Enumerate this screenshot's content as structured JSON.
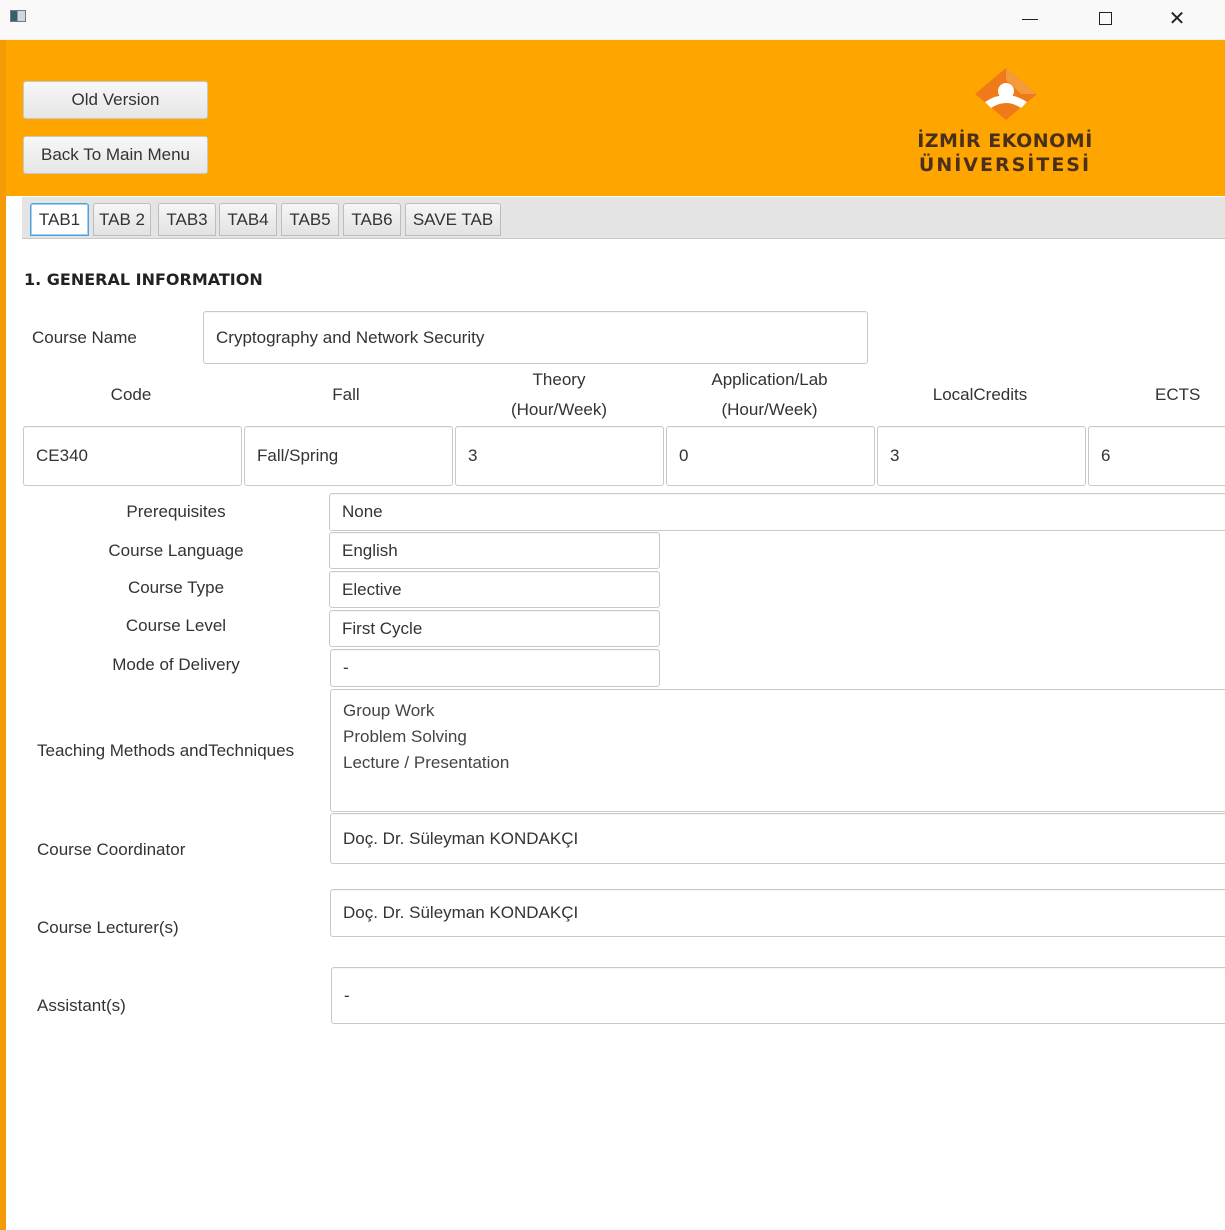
{
  "window": {
    "minimize_glyph": "—",
    "close_glyph": "✕"
  },
  "header": {
    "old_version_label": "Old Version",
    "back_label": "Back To Main Menu",
    "logo_line1": "İZMİR EKONOMİ",
    "logo_line2": "ÜNİVERSİTESİ",
    "brand_color": "#ffa500"
  },
  "tabs": [
    "TAB1",
    "TAB 2",
    "TAB3",
    "TAB4",
    "TAB5",
    "TAB6",
    "SAVE TAB"
  ],
  "active_tab": "TAB1",
  "form": {
    "section_title": "1. GENERAL INFORMATION",
    "course_name_label": "Course Name",
    "course_name": "Cryptography and Network Security",
    "columns": {
      "code": "Code",
      "fall": "Fall",
      "theory": [
        "Theory",
        "(Hour/Week)"
      ],
      "lab": [
        "Application/Lab",
        "(Hour/Week)"
      ],
      "local_credits": "LocalCredits",
      "ects": "ECTS"
    },
    "values": {
      "code": "CE340",
      "fall": "Fall/Spring",
      "theory": "3",
      "lab": "0",
      "local_credits": "3",
      "ects": "6"
    },
    "prerequisites_label": "Prerequisites",
    "prerequisites": "None",
    "language_label": "Course Language",
    "language": "English",
    "type_label": "Course Type",
    "type": "Elective",
    "level_label": "Course Level",
    "level": "First Cycle",
    "delivery_label": "Mode of Delivery",
    "delivery": "-",
    "methods_label": "Teaching Methods andTechniques",
    "methods": [
      "Group Work",
      "Problem Solving",
      "Lecture / Presentation"
    ],
    "coordinator_label": "Course Coordinator",
    "coordinator": "Doç. Dr. Süleyman KONDAKÇI",
    "lecturers_label": "Course Lecturer(s)",
    "lecturers": "Doç. Dr. Süleyman KONDAKÇI",
    "assistants_label": "Assistant(s)",
    "assistants": "-"
  }
}
